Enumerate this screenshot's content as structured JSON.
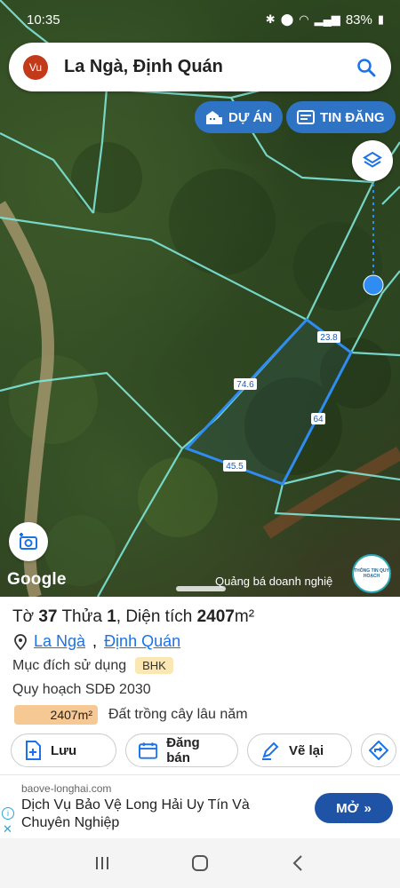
{
  "status_bar": {
    "time": "10:35",
    "battery": "83%"
  },
  "search": {
    "avatar": "Vu",
    "place": "La Ngà, Định Quán"
  },
  "map_buttons": {
    "du_an": "DỰ ÁN",
    "tin_dang": "TIN ĐĂNG"
  },
  "map": {
    "edges": [
      "23.8",
      "64",
      "45.5",
      "74.6"
    ],
    "google": "Google",
    "promo": "Quảng bá doanh nghiệ",
    "badge": "THÔNG TIN QUY HOẠCH"
  },
  "parcel": {
    "to_label": "Tờ",
    "to_value": "37",
    "thua_label": "Thửa",
    "thua_value": "1",
    "area_label": "Diện tích",
    "area_value": "2407",
    "area_unit": "m²",
    "commune": "La Ngà",
    "district": "Định Quán",
    "muc_dich_label": "Mục đích sử dụng",
    "muc_dich_code": "BHK",
    "quy_hoach_label": "Quy hoạch SDĐ 2030",
    "qh_area": "2407m²",
    "qh_desc": "Đất trồng cây lâu năm"
  },
  "actions": {
    "luu": "Lưu",
    "dang_ban": "Đăng bán",
    "ve_lai": "Vẽ lại"
  },
  "ad": {
    "domain": "baove-longhai.com",
    "headline": "Dịch Vụ Bảo Vệ Long Hải Uy Tín Và Chuyên Nghiệp",
    "cta": "MỞ"
  },
  "icons": {
    "search": "magnifier-icon",
    "layers": "layers-icon",
    "camera": "add-photo-icon",
    "pin": "location-pin-icon"
  }
}
